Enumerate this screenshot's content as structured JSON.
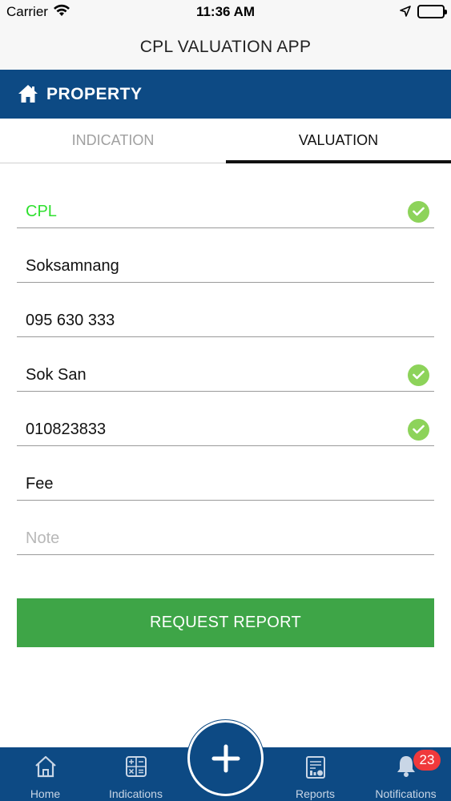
{
  "status_bar": {
    "carrier": "Carrier",
    "time": "11:36 AM"
  },
  "nav_bar": {
    "title": "CPL VALUATION APP"
  },
  "section": {
    "title": "PROPERTY",
    "icon": "house-icon"
  },
  "tabs": [
    {
      "label": "INDICATION",
      "active": false
    },
    {
      "label": "VALUATION",
      "active": true
    }
  ],
  "form": {
    "fields": [
      {
        "value": "CPL",
        "verified": true,
        "color": "#2fe02f"
      },
      {
        "value": "Soksamnang",
        "verified": false
      },
      {
        "value": "095 630 333",
        "verified": false
      },
      {
        "value": "Sok San",
        "verified": true
      },
      {
        "value": "010823833",
        "verified": true
      },
      {
        "value": "Fee",
        "verified": false
      },
      {
        "placeholder": "Note",
        "value": ""
      }
    ],
    "submit_label": "REQUEST REPORT"
  },
  "tab_bar": {
    "items": [
      {
        "label": "Home",
        "icon": "home-icon"
      },
      {
        "label": "Indications",
        "icon": "calculator-icon"
      },
      {
        "label": "Reports",
        "icon": "report-icon"
      },
      {
        "label": "Notifications",
        "icon": "bell-icon"
      }
    ],
    "fab_icon": "plus-icon",
    "notification_count": "23"
  },
  "colors": {
    "brand": "#0d4a84",
    "accent_green": "#3ea547",
    "check": "#8dd35a",
    "badge": "#f0393b"
  }
}
